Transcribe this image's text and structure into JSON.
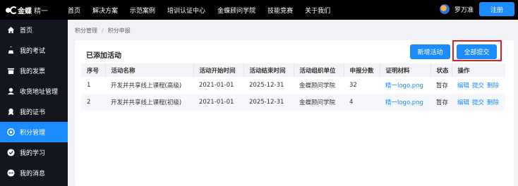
{
  "brand": {
    "name": "金蝶",
    "sub": "精一"
  },
  "nav": [
    "首页",
    "解决方案",
    "示范案例",
    "培训认证中心",
    "金蝶顾问学院",
    "技能竞赛",
    "关于我们"
  ],
  "user": {
    "name": "罗万准"
  },
  "register_label": "注册",
  "sidebar": [
    {
      "label": "首页",
      "icon": "home-icon",
      "active": false
    },
    {
      "label": "我的考试",
      "icon": "exam-icon",
      "active": false
    },
    {
      "label": "我的发票",
      "icon": "invoice-icon",
      "active": false
    },
    {
      "label": "收货地址管理",
      "icon": "address-icon",
      "active": false
    },
    {
      "label": "我的证书",
      "icon": "certificate-icon",
      "active": false
    },
    {
      "label": "积分管理",
      "icon": "points-icon",
      "active": true
    },
    {
      "label": "我的学习",
      "icon": "study-icon",
      "active": false
    },
    {
      "label": "我的消息",
      "icon": "message-icon",
      "active": false
    }
  ],
  "breadcrumb": [
    "积分管理",
    "积分申报"
  ],
  "card": {
    "title": "已添加活动",
    "new_label": "新增活动",
    "submit_label": "全部提交"
  },
  "table": {
    "headers": [
      "序号",
      "活动名称",
      "活动开始时间",
      "活动结束时间",
      "活动组织单位",
      "申报分数",
      "证明材料",
      "状态",
      "操作"
    ],
    "rows": [
      {
        "no": "1",
        "name": "开发并共享线上课程(高级)",
        "start": "2021-01-01",
        "end": "2025-12-31",
        "org": "金蝶顾问学院",
        "score": "32",
        "file": "精一logo.png",
        "status": "暂存",
        "ops": [
          "编辑",
          "提交",
          "删除"
        ]
      },
      {
        "no": "2",
        "name": "开发并共享线上课程(初级)",
        "start": "2021-01-01",
        "end": "2025-12-31",
        "org": "金蝶顾问学院",
        "score": "4",
        "file": "精一logo.png",
        "status": "暂存",
        "ops": [
          "编辑",
          "提交",
          "删除"
        ]
      }
    ]
  },
  "colors": {
    "accent": "#1a8cff",
    "highlight": "#e02020",
    "topbar": "#000000",
    "sidebar": "#13161f"
  }
}
